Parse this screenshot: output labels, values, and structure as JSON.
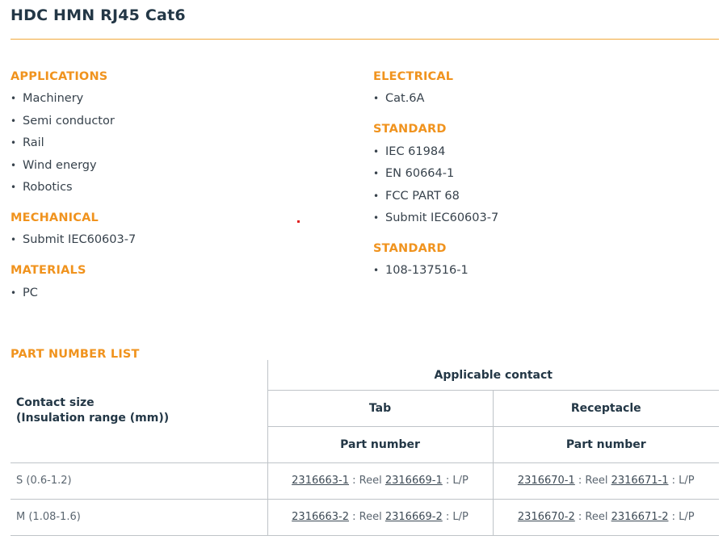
{
  "page": {
    "title": "HDC HMN RJ45 Cat6"
  },
  "left": {
    "applications": {
      "heading": "APPLICATIONS",
      "items": [
        "Machinery",
        "Semi conductor",
        "Rail",
        "Wind energy",
        "Robotics"
      ]
    },
    "mechanical": {
      "heading": "MECHANICAL",
      "items": [
        "Submit IEC60603-7"
      ]
    },
    "materials": {
      "heading": "MATERIALS",
      "items": [
        "PC"
      ]
    }
  },
  "right": {
    "electrical": {
      "heading": "ELECTRICAL",
      "items": [
        "Cat.6A"
      ]
    },
    "standard1": {
      "heading": "STANDARD",
      "items": [
        "IEC 61984",
        "EN 60664-1",
        "FCC PART 68",
        "Submit IEC60603-7"
      ]
    },
    "standard2": {
      "heading": "STANDARD",
      "items": [
        "108-137516-1"
      ]
    }
  },
  "bullet": "•",
  "part_list": {
    "heading": "PART NUMBER LIST",
    "header": {
      "contact_size_line1": "Contact size",
      "contact_size_line2": "(Insulation range (mm))",
      "applicable": "Applicable contact",
      "tab": "Tab",
      "receptacle": "Receptacle",
      "part_number_tab": "Part number",
      "part_number_rec": "Part number"
    },
    "rows": [
      {
        "size": "S (0.6-1.2)",
        "tab_pn": "2316663-1",
        "tab_reel_label": " : Reel ",
        "tab_reel": "2316669-1",
        "tab_suffix": " : L/P",
        "rec_pn": "2316670-1",
        "rec_reel_label": " : Reel ",
        "rec_reel": "2316671-1",
        "rec_suffix": " : L/P"
      },
      {
        "size": "M (1.08-1.6)",
        "tab_pn": "2316663-2",
        "tab_reel_label": " : Reel ",
        "tab_reel": "2316669-2",
        "tab_suffix": " : L/P",
        "rec_pn": "2316670-2",
        "rec_reel_label": " : Reel ",
        "rec_reel": "2316671-2",
        "rec_suffix": " : L/P"
      }
    ]
  },
  "colors": {
    "accent": "#f0931e",
    "title": "#233746",
    "rule": "#f2a93b",
    "grid": "#bfc4c8"
  }
}
